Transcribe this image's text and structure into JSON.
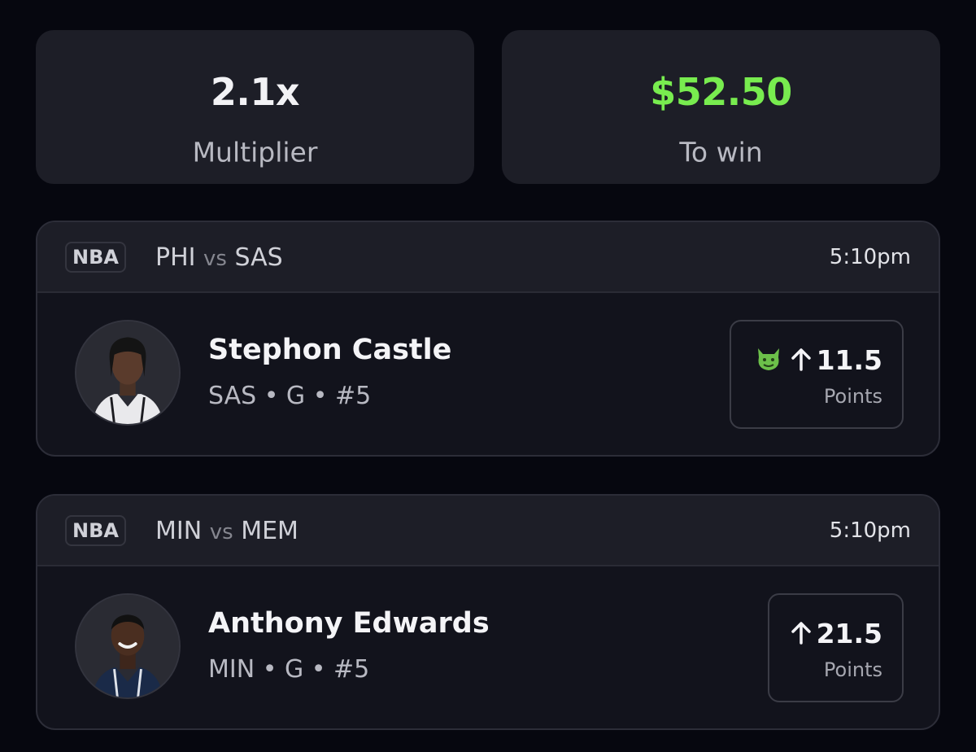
{
  "summary": {
    "multiplier": {
      "value": "2.1x",
      "label": "Multiplier"
    },
    "payout": {
      "value": "$52.50",
      "label": "To win",
      "color": "#78ec4f"
    }
  },
  "picks": [
    {
      "league": "NBA",
      "home": "PHI",
      "vs": "vs",
      "away": "SAS",
      "time": "5:10pm",
      "player_name": "Stephon Castle",
      "player_info": "SAS • G • #5",
      "direction_icon": "arrow-up-icon",
      "line": "11.5",
      "stat": "Points",
      "modifier_icon": "demon-icon"
    },
    {
      "league": "NBA",
      "home": "MIN",
      "vs": "vs",
      "away": "MEM",
      "time": "5:10pm",
      "player_name": "Anthony Edwards",
      "player_info": "MIN • G • #5",
      "direction_icon": "arrow-up-icon",
      "line": "21.5",
      "stat": "Points"
    }
  ]
}
